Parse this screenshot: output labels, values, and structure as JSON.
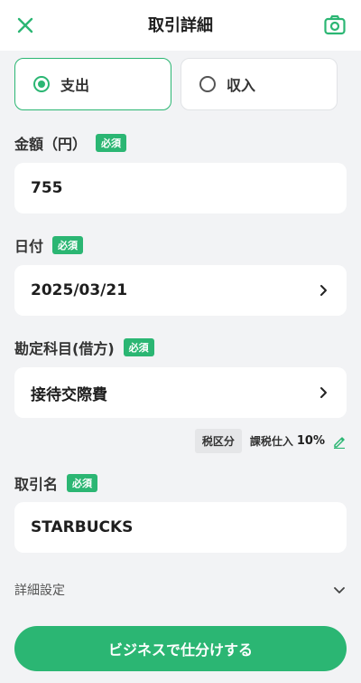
{
  "header": {
    "title": "取引詳細",
    "close_icon": "close-icon",
    "camera_icon": "camera-icon"
  },
  "type_toggle": {
    "options": [
      {
        "label": "支出",
        "selected": true
      },
      {
        "label": "収入",
        "selected": false
      }
    ]
  },
  "required_badge": "必須",
  "amount": {
    "label": "金額（円）",
    "value": "755"
  },
  "date": {
    "label": "日付",
    "value": "2025/03/21"
  },
  "account": {
    "label": "勘定科目(借方)",
    "value": "接待交際費"
  },
  "tax": {
    "chip": "税区分",
    "category": "課税仕入",
    "rate": "10%"
  },
  "transaction_name": {
    "label": "取引名",
    "value": "STARBUCKS"
  },
  "details": {
    "label": "詳細設定"
  },
  "submit": {
    "label": "ビジネスで仕分けする"
  },
  "colors": {
    "accent": "#2bb673",
    "background": "#f2f3f5",
    "surface": "#ffffff"
  }
}
